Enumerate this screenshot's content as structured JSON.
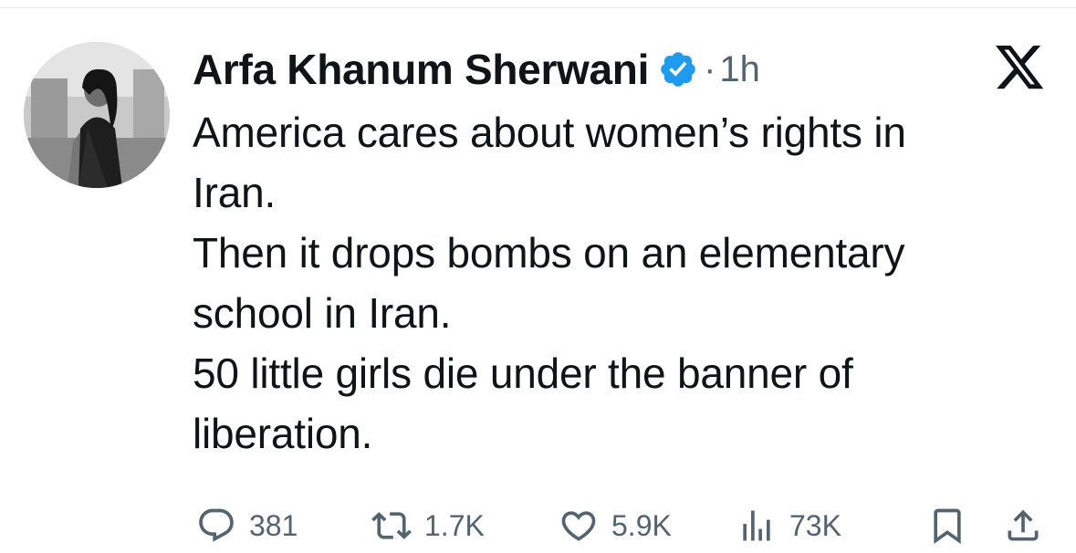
{
  "tweet": {
    "author_name": "Arfa Khanum Sherwani",
    "separator": "·",
    "time": "1h",
    "text_lines": [
      "America cares about women’s rights in",
      "Iran.",
      "Then it drops bombs on an elementary",
      "school in Iran.",
      "50 little girls die under the banner of",
      "liberation."
    ],
    "verified": true
  },
  "actions": {
    "reply": {
      "icon": "reply-icon",
      "count": "381"
    },
    "retweet": {
      "icon": "retweet-icon",
      "count": "1.7K"
    },
    "like": {
      "icon": "heart-icon",
      "count": "5.9K"
    },
    "views": {
      "icon": "views-icon",
      "count": "73K"
    },
    "bookmark": {
      "icon": "bookmark-icon"
    },
    "share": {
      "icon": "share-icon"
    }
  },
  "colors": {
    "text": "#0f1419",
    "muted": "#536471",
    "verified_blue": "#1d9bf0",
    "divider": "#e6e9ec"
  }
}
